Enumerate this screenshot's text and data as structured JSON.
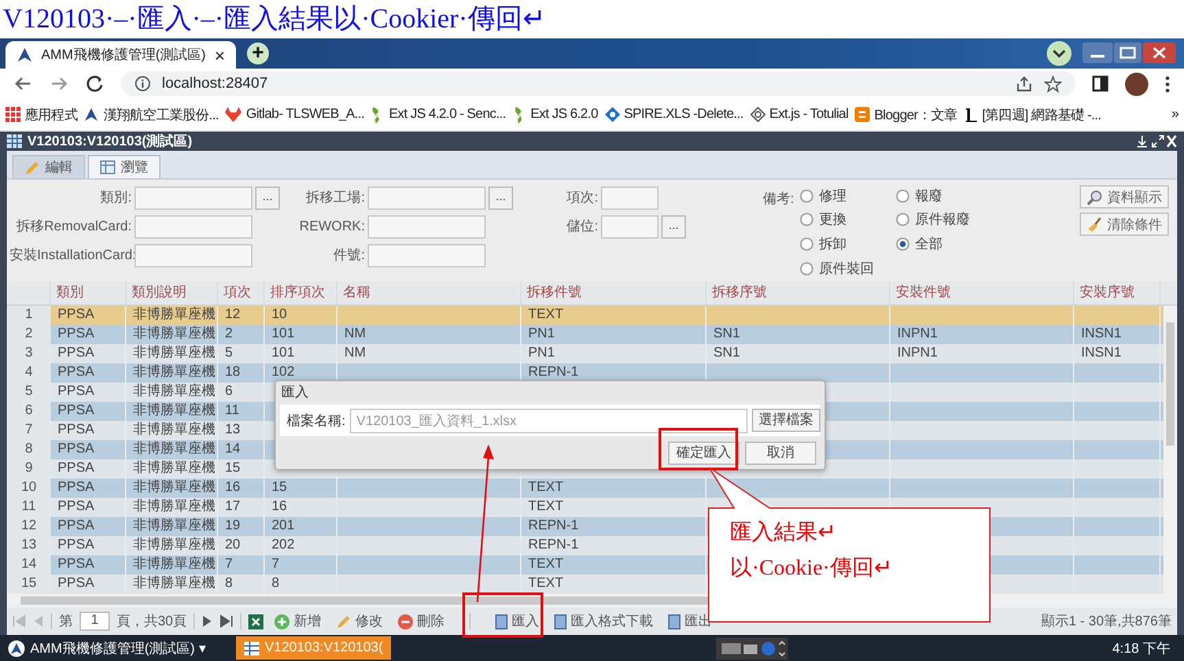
{
  "document_heading": "V120103·–·匯入·–·匯入結果以·Cookier·傳回↵",
  "browser": {
    "tabs": [
      {
        "title": "AMM飛機修護管理(測試區)",
        "close": "×",
        "selected": true
      }
    ],
    "new_tab": "+",
    "address": "localhost:28407",
    "bookmarks": [
      {
        "label": "應用程式",
        "kind": "apps"
      },
      {
        "label": "漢翔航空工業股份...",
        "kind": "logo"
      },
      {
        "label": "Gitlab- TLSWEB_A...",
        "kind": "gitlab"
      },
      {
        "label": "Ext JS 4.2.0 - Senc...",
        "kind": "ext"
      },
      {
        "label": "Ext JS 6.2.0",
        "kind": "ext"
      },
      {
        "label": "SPIRE.XLS -Delete...",
        "kind": "spire"
      },
      {
        "label": "Ext.js - Totulial",
        "kind": "globe"
      },
      {
        "label": "Blogger：文章",
        "kind": "blogger"
      },
      {
        "label": "[第四週] 網路基礎 -...",
        "kind": "letter"
      }
    ],
    "more_bookmarks": "»"
  },
  "app_window": {
    "title": "V120103:V120103(測試區)",
    "tabs": [
      {
        "label": "編輯",
        "kind": "edit",
        "selected": false
      },
      {
        "label": "瀏覽",
        "kind": "grid",
        "selected": true
      }
    ]
  },
  "filters": {
    "columns": [
      [
        {
          "label": "類別:",
          "lookup": "..."
        },
        {
          "label": "拆移RemovalCard:"
        },
        {
          "label": "安裝InstallationCard:"
        }
      ],
      [
        {
          "label": "拆移工場:",
          "lookup": "..."
        },
        {
          "label": "REWORK:"
        },
        {
          "label": "件號:"
        }
      ],
      [
        {
          "label": "項次:"
        },
        {
          "label": "儲位:",
          "lookup": "..."
        }
      ]
    ],
    "remark_label": "備考:",
    "remark_options": [
      {
        "label": "修理",
        "selected": false
      },
      {
        "label": "報廢",
        "selected": false
      },
      {
        "label": "更換",
        "selected": false
      },
      {
        "label": "原件報廢",
        "selected": false
      },
      {
        "label": "拆卸",
        "selected": false
      },
      {
        "label": "全部",
        "selected": true
      },
      {
        "label": "原件裝回",
        "selected": false
      }
    ],
    "buttons": [
      {
        "label": "資料顯示",
        "kind": "search"
      },
      {
        "label": "清除條件",
        "kind": "clear"
      }
    ]
  },
  "table": {
    "columns": [
      "類別",
      "類別說明",
      "項次",
      "排序項次",
      "名稱",
      "拆移件號",
      "拆移序號",
      "安裝件號",
      "安裝序號"
    ],
    "rows": [
      {
        "number": "1",
        "selected": true,
        "cells": [
          "PPSA",
          "非博勝單座機",
          "12",
          "10",
          null,
          "TEXT",
          null,
          null,
          null
        ]
      },
      {
        "number": "2",
        "selected": false,
        "cells": [
          "PPSA",
          "非博勝單座機",
          "2",
          "101",
          "NM",
          "PN1",
          "SN1",
          "INPN1",
          "INSN1"
        ]
      },
      {
        "number": "3",
        "selected": false,
        "cells": [
          "PPSA",
          "非博勝單座機",
          "5",
          "101",
          "NM",
          "PN1",
          "SN1",
          "INPN1",
          "INSN1"
        ]
      },
      {
        "number": "4",
        "selected": false,
        "cells": [
          "PPSA",
          "非博勝單座機",
          "18",
          "102",
          null,
          "REPN-1",
          null,
          null,
          null
        ]
      },
      {
        "number": "5",
        "selected": false,
        "cells": [
          "PPSA",
          "非博勝單座機",
          "6",
          null,
          null,
          null,
          null,
          null,
          null
        ]
      },
      {
        "number": "6",
        "selected": false,
        "cells": [
          "PPSA",
          "非博勝單座機",
          "11",
          null,
          null,
          null,
          null,
          null,
          null
        ]
      },
      {
        "number": "7",
        "selected": false,
        "cells": [
          "PPSA",
          "非博勝單座機",
          "13",
          null,
          null,
          null,
          null,
          null,
          null
        ]
      },
      {
        "number": "8",
        "selected": false,
        "cells": [
          "PPSA",
          "非博勝單座機",
          "14",
          null,
          null,
          null,
          null,
          null,
          null
        ]
      },
      {
        "number": "9",
        "selected": false,
        "cells": [
          "PPSA",
          "非博勝單座機",
          "15",
          null,
          null,
          null,
          null,
          null,
          null
        ]
      },
      {
        "number": "10",
        "selected": false,
        "cells": [
          "PPSA",
          "非博勝單座機",
          "16",
          "15",
          null,
          "TEXT",
          null,
          null,
          null
        ]
      },
      {
        "number": "11",
        "selected": false,
        "cells": [
          "PPSA",
          "非博勝單座機",
          "17",
          "16",
          null,
          "TEXT",
          null,
          null,
          null
        ]
      },
      {
        "number": "12",
        "selected": false,
        "cells": [
          "PPSA",
          "非博勝單座機",
          "19",
          "201",
          null,
          "REPN-1",
          null,
          null,
          null
        ]
      },
      {
        "number": "13",
        "selected": false,
        "cells": [
          "PPSA",
          "非博勝單座機",
          "20",
          "202",
          null,
          "REPN-1",
          null,
          null,
          null
        ]
      },
      {
        "number": "14",
        "selected": false,
        "cells": [
          "PPSA",
          "非博勝單座機",
          "7",
          "7",
          null,
          "TEXT",
          null,
          null,
          null
        ]
      },
      {
        "number": "15",
        "selected": false,
        "cells": [
          "PPSA",
          "非博勝單座機",
          "8",
          "8",
          null,
          "TEXT",
          null,
          null,
          null
        ]
      }
    ]
  },
  "pager": {
    "page_prefix": "第",
    "page": "1",
    "page_suffix": "頁，共30頁",
    "actions": [
      {
        "label": "新增",
        "kind": "add"
      },
      {
        "label": "修改",
        "kind": "edit"
      },
      {
        "label": "刪除",
        "kind": "delete"
      },
      {
        "label": "匯入",
        "kind": "doc"
      },
      {
        "label": "匯入格式下載",
        "kind": "doc"
      },
      {
        "label": "匯出",
        "kind": "doc"
      }
    ],
    "summary": "顯示1 - 30筆,共876筆"
  },
  "import_dialog": {
    "title": "匯入",
    "field_label": "檔案名稱:",
    "file_name": "V120103_匯入資料_1.xlsx",
    "browse": "選擇檔案",
    "confirm": "確定匯入",
    "cancel": "取消"
  },
  "callout": {
    "lines": [
      "匯入結果↵",
      "以·Cookie·傳回↵"
    ]
  },
  "taskbar": {
    "app_menu": "AMM飛機修護管理(測試區) ▾",
    "tasks": [
      {
        "label": "V120103:V120103(",
        "selected": true
      }
    ],
    "clock": "4:18 下午"
  }
}
